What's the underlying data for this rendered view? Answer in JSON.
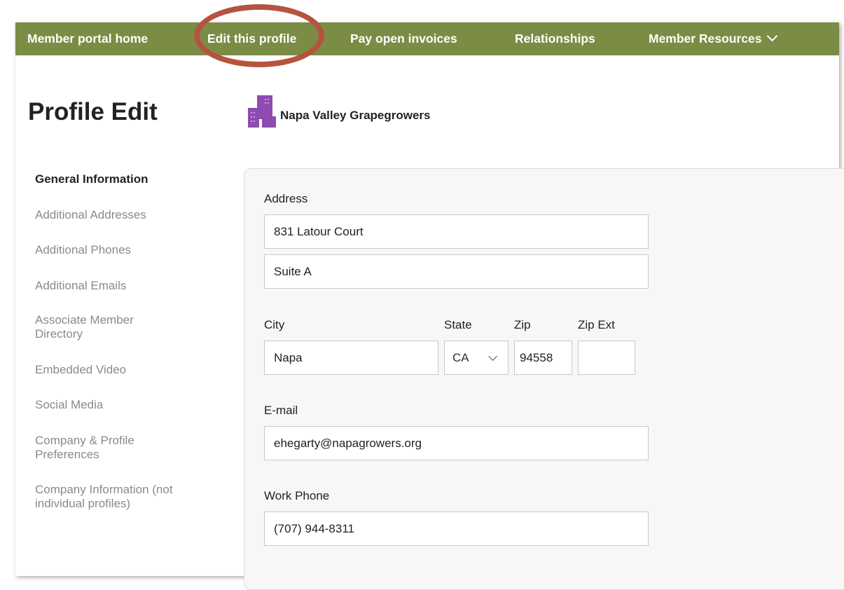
{
  "nav": {
    "items": [
      {
        "label": "Member portal home"
      },
      {
        "label": "Edit this profile"
      },
      {
        "label": "Pay open invoices"
      },
      {
        "label": "Relationships"
      },
      {
        "label": "Member Resources"
      }
    ]
  },
  "page": {
    "title": "Profile Edit",
    "organization": "Napa Valley Grapegrowers"
  },
  "sidebar": {
    "items": [
      {
        "label": "General Information",
        "active": true
      },
      {
        "label": "Additional Addresses"
      },
      {
        "label": "Additional Phones"
      },
      {
        "label": "Additional Emails"
      },
      {
        "label": "Associate Member Directory"
      },
      {
        "label": "Embedded Video"
      },
      {
        "label": "Social Media"
      },
      {
        "label": "Company & Profile Preferences"
      },
      {
        "label": "Company Information (not individual profiles)"
      }
    ]
  },
  "form": {
    "address_label": "Address",
    "address_line1": "831 Latour Court",
    "address_line2": "Suite A",
    "city_label": "City",
    "city": "Napa",
    "state_label": "State",
    "state": "CA",
    "zip_label": "Zip",
    "zip": "94558",
    "zip_ext_label": "Zip Ext",
    "zip_ext": "",
    "email_label": "E-mail",
    "email": "ehegarty@napagrowers.org",
    "work_phone_label": "Work Phone",
    "work_phone": "(707) 944-8311"
  },
  "colors": {
    "nav_bg": "#7b8c45",
    "highlight_ring": "#b5533e",
    "org_icon": "#8e4bb0"
  },
  "icons": {
    "nav_dropdown": "chevron-down-icon",
    "organization": "building-icon",
    "state_select": "chevron-down-icon"
  }
}
